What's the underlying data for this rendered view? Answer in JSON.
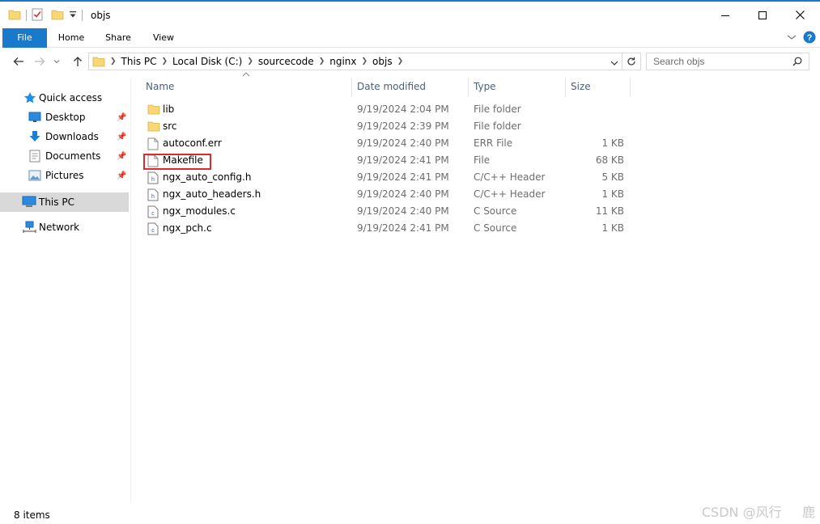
{
  "window": {
    "title": "objs",
    "controls": [
      "minimize",
      "maximize",
      "close"
    ]
  },
  "ribbon": {
    "tabs": [
      "File",
      "Home",
      "Share",
      "View"
    ]
  },
  "address": {
    "crumbs": [
      "This PC",
      "Local Disk (C:)",
      "sourcecode",
      "nginx",
      "objs"
    ]
  },
  "search": {
    "placeholder": "Search objs"
  },
  "nav": {
    "quick_access": "Quick access",
    "pinned": [
      "Desktop",
      "Downloads",
      "Documents",
      "Pictures"
    ],
    "this_pc": "This PC",
    "network": "Network"
  },
  "columns": {
    "name": "Name",
    "date": "Date modified",
    "type": "Type",
    "size": "Size"
  },
  "files": [
    {
      "name": "lib",
      "date": "9/19/2024 2:04 PM",
      "type": "File folder",
      "size": "",
      "icon": "folder"
    },
    {
      "name": "src",
      "date": "9/19/2024 2:39 PM",
      "type": "File folder",
      "size": "",
      "icon": "folder"
    },
    {
      "name": "autoconf.err",
      "date": "9/19/2024 2:40 PM",
      "type": "ERR File",
      "size": "1 KB",
      "icon": "file"
    },
    {
      "name": "Makefile",
      "date": "9/19/2024 2:41 PM",
      "type": "File",
      "size": "68 KB",
      "icon": "file"
    },
    {
      "name": "ngx_auto_config.h",
      "date": "9/19/2024 2:41 PM",
      "type": "C/C++ Header",
      "size": "5 KB",
      "icon": "c-header"
    },
    {
      "name": "ngx_auto_headers.h",
      "date": "9/19/2024 2:40 PM",
      "type": "C/C++ Header",
      "size": "1 KB",
      "icon": "c-header"
    },
    {
      "name": "ngx_modules.c",
      "date": "9/19/2024 2:40 PM",
      "type": "C Source",
      "size": "11 KB",
      "icon": "c-source"
    },
    {
      "name": "ngx_pch.c",
      "date": "9/19/2024 2:41 PM",
      "type": "C Source",
      "size": "1 KB",
      "icon": "c-source"
    }
  ],
  "highlighted_file": "Makefile",
  "status": {
    "item_count": "8 items"
  },
  "watermark": "CSDN @风行     鹿",
  "colors": {
    "accent": "#1979ca",
    "highlight": "#e0282e",
    "selected": "#cce8ff"
  }
}
